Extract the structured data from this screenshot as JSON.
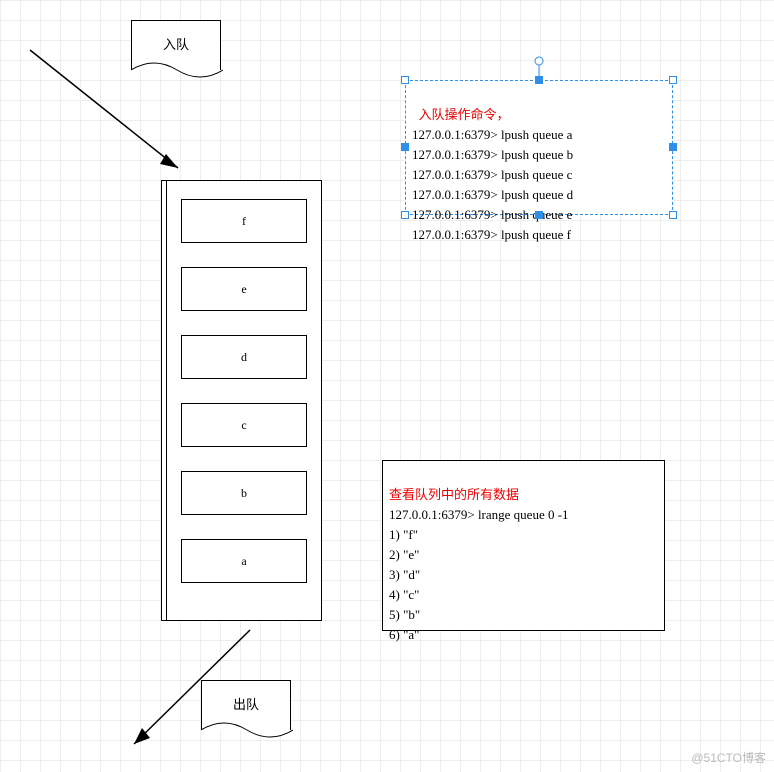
{
  "labels": {
    "enqueue": "入队",
    "dequeue": "出队"
  },
  "queue_cells": [
    "f",
    "e",
    "d",
    "c",
    "b",
    "a"
  ],
  "enqueue_panel": {
    "title": "入队操作命令，",
    "lines": [
      "127.0.0.1:6379> lpush queue a",
      "127.0.0.1:6379> lpush queue b",
      "127.0.0.1:6379> lpush queue c",
      "127.0.0.1:6379> lpush queue d",
      "127.0.0.1:6379> lpush queue e",
      "127.0.0.1:6379> lpush queue f"
    ]
  },
  "view_panel": {
    "title": "查看队列中的所有数据",
    "lines": [
      "127.0.0.1:6379> lrange queue 0 -1",
      "1) \"f\"",
      "2) \"e\"",
      "3) \"d\"",
      "4) \"c\"",
      "5) \"b\"",
      "6) \"a\""
    ]
  },
  "watermark": "@51CTO博客"
}
